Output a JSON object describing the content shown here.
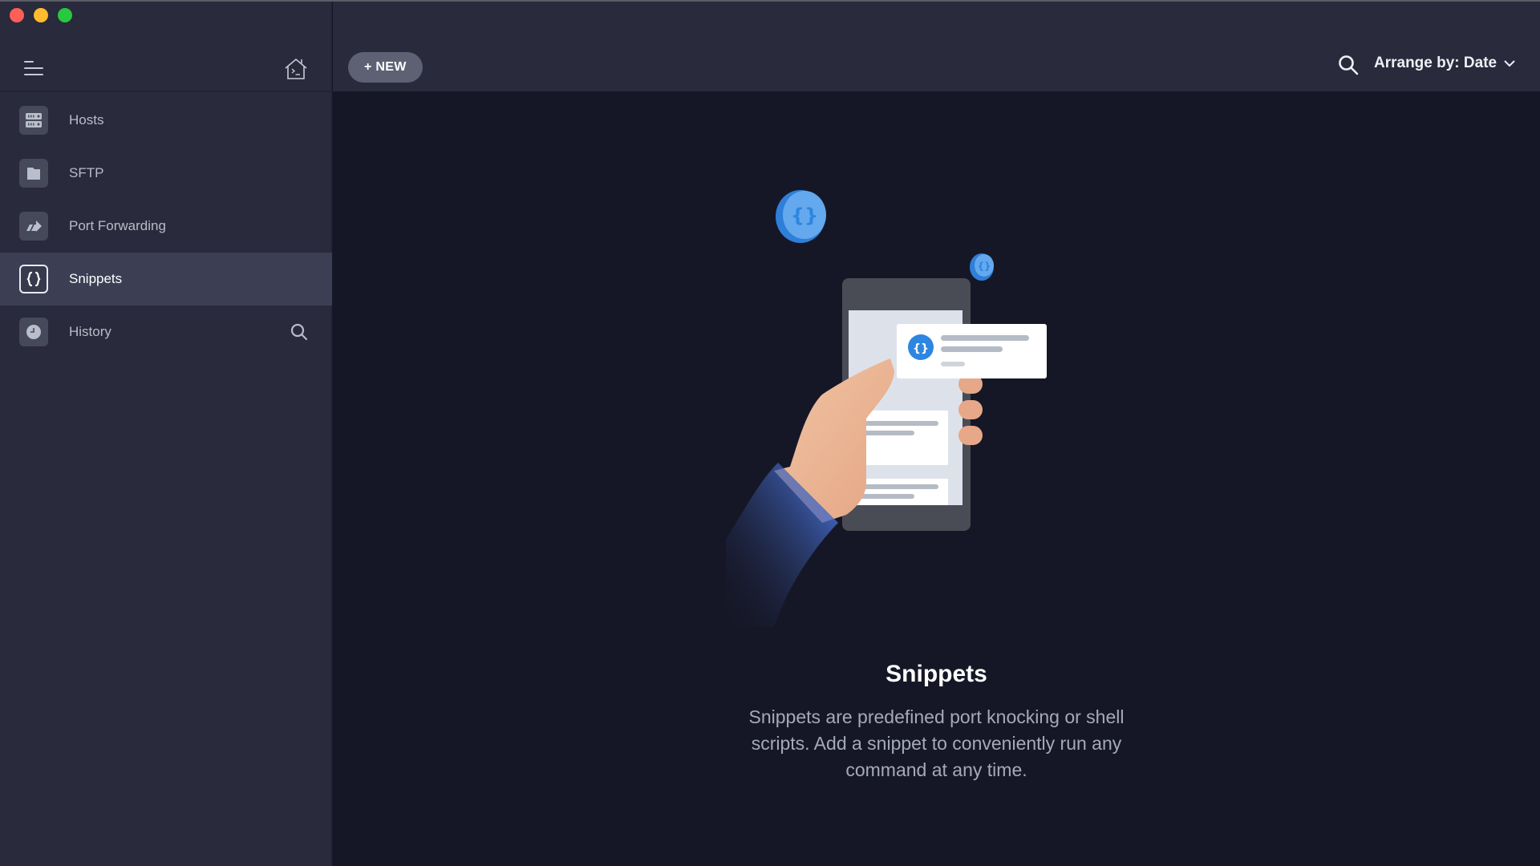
{
  "window": {
    "traffic_lights": [
      "close",
      "minimize",
      "maximize"
    ]
  },
  "sidebar": {
    "menu_icon": "hamburger-menu-icon",
    "home_icon": "terminal-home-icon",
    "items": [
      {
        "label": "Hosts",
        "icon": "server-rack-icon",
        "active": false
      },
      {
        "label": "SFTP",
        "icon": "folder-icon",
        "active": false
      },
      {
        "label": "Port Forwarding",
        "icon": "port-forward-arrow-icon",
        "active": false
      },
      {
        "label": "Snippets",
        "icon": "curly-braces-icon",
        "active": true
      },
      {
        "label": "History",
        "icon": "clock-icon",
        "active": false,
        "trailing_icon": "search-icon"
      }
    ]
  },
  "toolbar": {
    "new_label": "+ NEW",
    "search_icon": "search-icon",
    "arrange_label": "Arrange by: Date",
    "arrange_icon": "chevron-down-icon"
  },
  "empty_state": {
    "illustration": "hand-holding-phone-with-snippet-card",
    "title": "Snippets",
    "description": "Snippets are predefined port knocking or shell scripts. Add a snippet to conveniently run any command at any time."
  },
  "colors": {
    "sidebar_bg": "#292a3b",
    "sidebar_active_bg": "#3c3f54",
    "main_bg": "#161726",
    "new_button_bg": "#5d6173",
    "accent_blue": "#2d86e0"
  }
}
